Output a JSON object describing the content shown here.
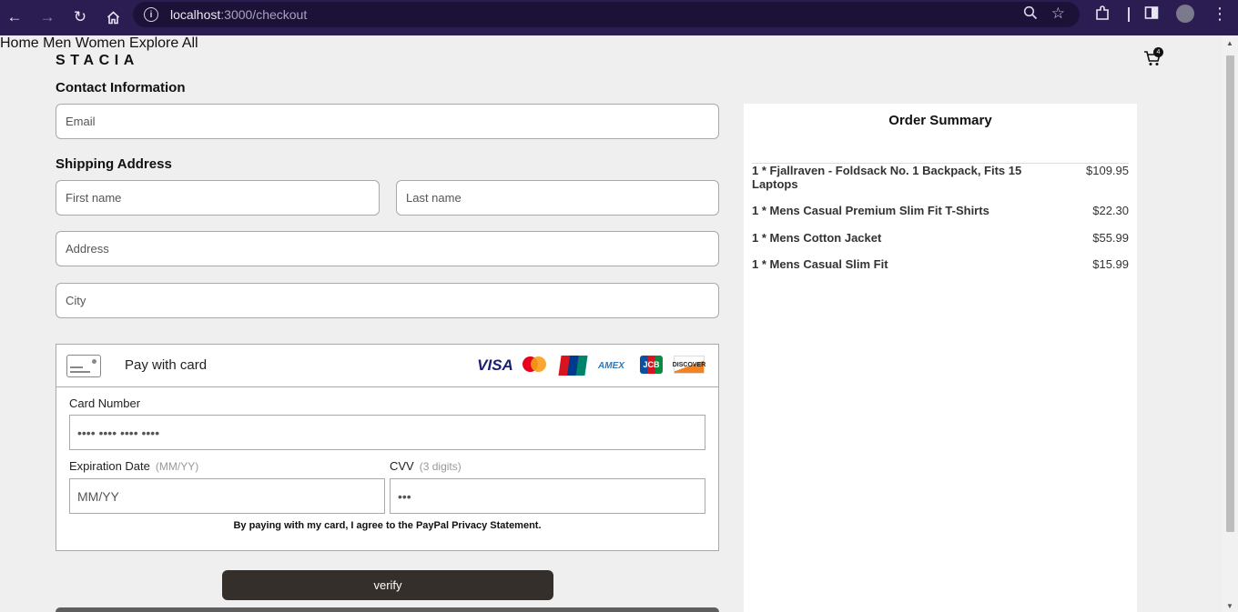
{
  "browser": {
    "url_host": "localhost",
    "url_path": ":3000/checkout"
  },
  "header": {
    "logo": "STACIA",
    "nav": [
      "Home",
      "Men",
      "Women",
      "Explore All"
    ],
    "cart_count": "4"
  },
  "form": {
    "contact_title": "Contact Information",
    "email_placeholder": "Email",
    "shipping_title": "Shipping Address",
    "first_name_placeholder": "First name",
    "last_name_placeholder": "Last name",
    "address_placeholder": "Address",
    "city_placeholder": "City"
  },
  "payment": {
    "pay_with_card": "Pay with card",
    "brands": [
      "VISA",
      "Mastercard",
      "UnionPay",
      "AMEX",
      "JCB",
      "DISCOVER"
    ],
    "card_number_label": "Card Number",
    "card_number_placeholder": "•••• •••• •••• ••••",
    "expiration_label": "Expiration Date",
    "expiration_hint": "(MM/YY)",
    "expiration_placeholder": "MM/YY",
    "cvv_label": "CVV",
    "cvv_hint": "(3 digits)",
    "cvv_placeholder": "•••",
    "agreement": "By paying with my card, I agree to the PayPal Privacy Statement.",
    "verify_label": "verify"
  },
  "summary": {
    "title": "Order Summary",
    "items": [
      {
        "name": "1 * Fjallraven - Foldsack No. 1 Backpack, Fits 15 Laptops",
        "price": "$109.95"
      },
      {
        "name": "1 * Mens Casual Premium Slim Fit T-Shirts",
        "price": "$22.30"
      },
      {
        "name": "1 * Mens Cotton Jacket",
        "price": "$55.99"
      },
      {
        "name": "1 * Mens Casual Slim Fit",
        "price": "$15.99"
      }
    ]
  },
  "colors": {
    "browser_chrome": "#2b1d52",
    "page_background": "#efefef",
    "verify_button": "#352f2c"
  }
}
